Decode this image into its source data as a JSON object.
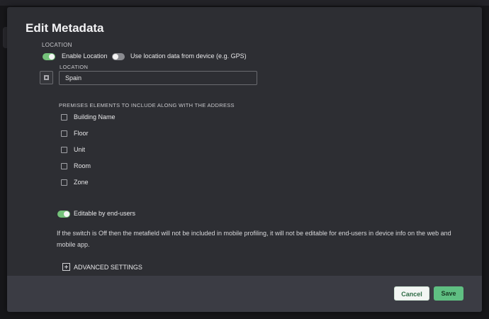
{
  "modal": {
    "title": "Edit Metadata",
    "section_label": "LOCATION",
    "enable_location": {
      "label": "Enable Location",
      "checked": true
    },
    "use_device_location": {
      "label": "Use location data from device (e.g. GPS)",
      "checked": false
    },
    "location_field": {
      "label": "LOCATION",
      "value": "Spain"
    },
    "premises": {
      "heading": "PREMISES ELEMENTS TO INCLUDE ALONG WITH THE ADDRESS",
      "items": [
        {
          "label": "Building Name",
          "checked": false
        },
        {
          "label": "Floor",
          "checked": false
        },
        {
          "label": "Unit",
          "checked": false
        },
        {
          "label": "Room",
          "checked": false
        },
        {
          "label": "Zone",
          "checked": false
        }
      ]
    },
    "editable_by_end_users": {
      "label": "Editable by end-users",
      "checked": true
    },
    "help_text": "If the switch is Off then the metafield will not be included in mobile profiling, it will not be editable for end-users in device info on the web and mobile app.",
    "advanced_settings_label": "ADVANCED SETTINGS",
    "footer": {
      "cancel_label": "Cancel",
      "save_label": "Save"
    }
  },
  "colors": {
    "accent_green": "#74c27a",
    "save_button": "#5fbf82",
    "modal_bg": "#2d2e33",
    "footer_bg": "#3b3c44"
  }
}
